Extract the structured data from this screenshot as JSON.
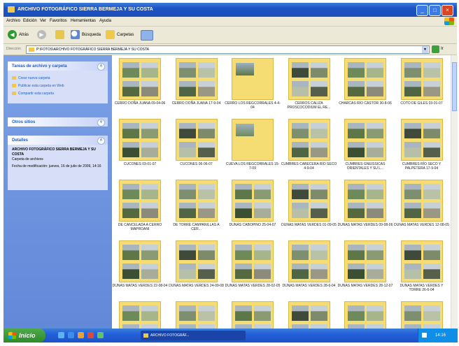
{
  "window": {
    "title": "ARCHIVO FOTOGRÁFICO SIERRA BERMEJA Y SU COSTA"
  },
  "menu": [
    "Archivo",
    "Edición",
    "Ver",
    "Favoritos",
    "Herramientas",
    "Ayuda"
  ],
  "toolbar": {
    "back": "Atrás",
    "search": "Búsqueda",
    "folders": "Carpetas"
  },
  "address": {
    "label": "Dirección",
    "path": "P:\\FOTOS\\ARCHIVO FOTOGRÁFICO SIERRA BERMEJA Y SU COSTA",
    "go": "Ir"
  },
  "tasks": {
    "title": "Tareas de archivo y carpeta",
    "items": [
      "Crear nueva carpeta",
      "Publicar esta carpeta en Web",
      "Compartir esta carpeta"
    ]
  },
  "other": {
    "title": "Otros sitios"
  },
  "details": {
    "title": "Detalles",
    "name": "ARCHIVO FOTOGRÁFICO SIERRA BERMEJA Y SU COSTA",
    "type": "Carpeta de archivos",
    "modified": "Fecha de modificación: jueves, 16 de julio de 2009, 14:16"
  },
  "folders": [
    {
      "label": "CERRO DOÑA JUANA 09-04-06",
      "kind": "grid"
    },
    {
      "label": "CERRO DOÑA JUANA 17-9-04",
      "kind": "grid"
    },
    {
      "label": "CERRO LOS REGCORRALES 4-4-04",
      "kind": "single"
    },
    {
      "label": "CERROS CALIZA PROSCOCODIUM EL RE...",
      "kind": "grid"
    },
    {
      "label": "CHARCAS RÍO CASTOR 30-8-06",
      "kind": "grid"
    },
    {
      "label": "COTO DE GILES 03-01-07",
      "kind": "grid"
    },
    {
      "label": "CUCONES 03-01-07",
      "kind": "grid"
    },
    {
      "label": "CUCONES 06-06-07",
      "kind": "grid"
    },
    {
      "label": "CUEVA LOS REGCORRALES 15-7-09",
      "kind": "single"
    },
    {
      "label": "CUMBRES CABECERA RÍO SECO 4-9-04",
      "kind": "grid"
    },
    {
      "label": "CUMBRES GNEISSICAS ORIENTALES Y SU L...",
      "kind": "grid"
    },
    {
      "label": "CUMBRES RÍO SECO Y PALPETERA 17-9-04",
      "kind": "grid"
    },
    {
      "label": "DE CANCELADA A CERRO MAPROANI",
      "kind": "grid"
    },
    {
      "label": "DE TORRE CAMPANILLAS A CER...",
      "kind": "grid"
    },
    {
      "label": "DUNAS CABOPINO 25-04-07",
      "kind": "grid"
    },
    {
      "label": "DUNAS MATAS VERDES 01-09-05",
      "kind": "grid"
    },
    {
      "label": "DUNAS MATAS VERDES 09-08-06",
      "kind": "grid"
    },
    {
      "label": "DUNAS MATAS VERDES 12-08-05",
      "kind": "grid"
    },
    {
      "label": "DUNAS MATAS VERDES 22-08-04",
      "kind": "grid"
    },
    {
      "label": "DUNAS MATAS VERDES 24-09-08",
      "kind": "grid"
    },
    {
      "label": "DUNAS MATAS VERDES 28-02-05",
      "kind": "grid"
    },
    {
      "label": "DUNAS MATAS VERDES 28-6-04",
      "kind": "grid"
    },
    {
      "label": "DUNAS MATAS VERDES 28-12-07",
      "kind": "grid"
    },
    {
      "label": "DUNAS MATAS VERDES Y TORRE 26-6-04",
      "kind": "grid"
    },
    {
      "label": "",
      "kind": "grid"
    },
    {
      "label": "",
      "kind": "grid"
    },
    {
      "label": "",
      "kind": "grid"
    },
    {
      "label": "",
      "kind": "grid"
    },
    {
      "label": "",
      "kind": "grid"
    },
    {
      "label": "",
      "kind": "grid"
    }
  ],
  "taskbar": {
    "start": "Inicio",
    "task": "ARCHIVO FOTOGRÁF...",
    "clock": "14:16"
  }
}
